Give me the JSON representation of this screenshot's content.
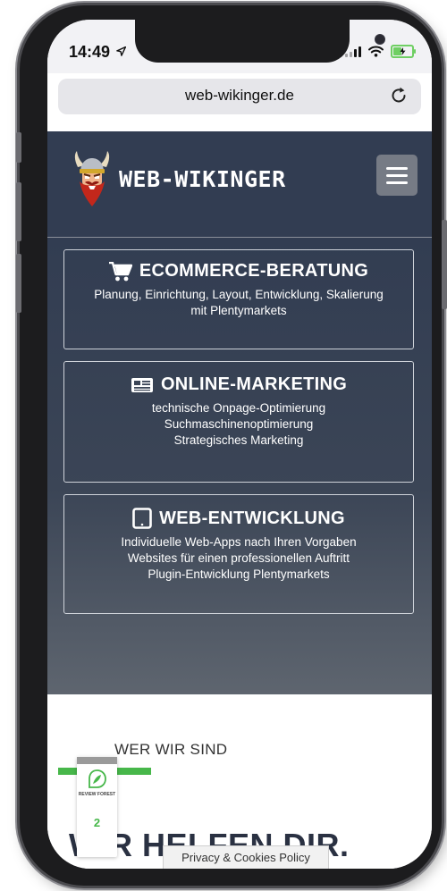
{
  "status_bar": {
    "time": "14:49",
    "location_icon": "location-arrow-icon",
    "signal_icon": "cellular-signal-icon",
    "wifi_icon": "wifi-icon",
    "battery_icon": "battery-charging-icon",
    "battery_color": "#6fcf63",
    "battery_level": 0.5
  },
  "browser": {
    "url": "web-wikinger.de",
    "reload_icon": "reload-icon"
  },
  "header": {
    "logo_text": "WEB-WIKINGER",
    "logo_icon": "viking-mascot-icon",
    "menu_icon": "hamburger-menu-icon",
    "background_color": "#323d52"
  },
  "services": [
    {
      "icon": "shopping-cart-icon",
      "title": "ECOMMERCE-BERATUNG",
      "lines": [
        "Planung, Einrichtung, Layout, Entwicklung, Skalierung",
        "mit Plentymarkets"
      ]
    },
    {
      "icon": "newspaper-icon",
      "title": "ONLINE-MARKETING",
      "lines": [
        "technische Onpage-Optimierung",
        "Suchmaschinenoptimierung",
        "Strategisches Marketing"
      ]
    },
    {
      "icon": "tablet-icon",
      "title": "WEB-ENTWICKLUNG",
      "lines": [
        "Individuelle Web-Apps nach Ihren Vorgaben",
        "Websites für einen professionellen Auftritt",
        "Plugin-Entwicklung Plentymarkets"
      ]
    }
  ],
  "about": {
    "label": "WER WIR SIND",
    "heading": "WIR HELFEN DIR.",
    "accent_color": "#47b74a"
  },
  "review_widget": {
    "icon": "review-forest-leaf-icon",
    "text": "REVIEW FOREST",
    "count": "2"
  },
  "privacy_tab": {
    "label": "Privacy & Cookies Policy"
  }
}
